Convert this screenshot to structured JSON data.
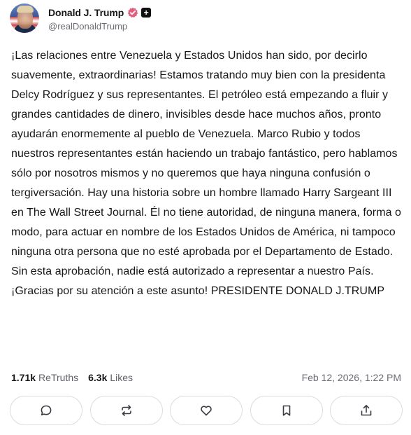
{
  "author": {
    "display_name": "Donald J. Trump",
    "handle": "@realDonaldTrump",
    "verified_icon": "verified-badge-icon",
    "plus_badge": "+"
  },
  "post": {
    "text": "¡Las relaciones entre Venezuela y Estados Unidos han sido, por decirlo suavemente, extraordinarias! Estamos tratando muy bien con la presidenta Delcy Rodríguez y sus representantes. El petróleo está empezando a fluir y grandes cantidades de dinero, invisibles desde hace muchos años, pronto ayudarán enormemente al pueblo de Venezuela. Marco Rubio y todos nuestros representantes están haciendo un trabajo fantástico, pero hablamos sólo por nosotros mismos y no queremos que haya ninguna confusión o tergiversación. Hay una historia sobre un hombre llamado Harry Sargeant III en The Wall Street Journal. Él no tiene autoridad, de ninguna manera, forma o modo, para actuar en nombre de los Estados Unidos de América, ni tampoco ninguna otra persona que no esté aprobada por el Departamento de Estado. Sin esta aprobación, nadie está autorizado a representar a nuestro País. ¡Gracias por su atención a este asunto! PRESIDENTE DONALD J.TRUMP"
  },
  "stats": {
    "retruths_count": "1.71k",
    "retruths_label": "ReTruths",
    "likes_count": "6.3k",
    "likes_label": "Likes",
    "timestamp": "Feb 12, 2026, 1:22 PM"
  },
  "actions": [
    "reply-icon",
    "retruth-icon",
    "like-icon",
    "bookmark-icon",
    "share-icon"
  ],
  "colors": {
    "verified": "#e0607e",
    "text": "#17171a",
    "muted": "#6b6b73",
    "border": "#dcdce0"
  }
}
